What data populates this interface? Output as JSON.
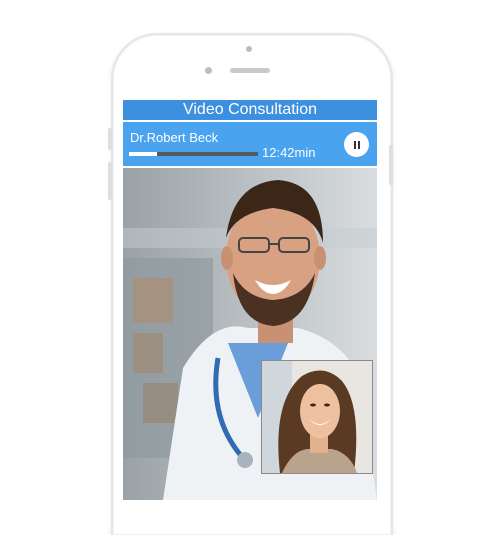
{
  "app": {
    "title": "Video Consultation"
  },
  "call": {
    "caller_name": "Dr.Robert Beck",
    "duration": "12:42min",
    "progress": 0.22
  },
  "controls": {
    "pause_icon": "pause-icon"
  },
  "colors": {
    "title_bar": "#3d8fe0",
    "call_bar": "#4aa3ee",
    "progress_fill": "#ffffff",
    "progress_track": "#555a60"
  }
}
